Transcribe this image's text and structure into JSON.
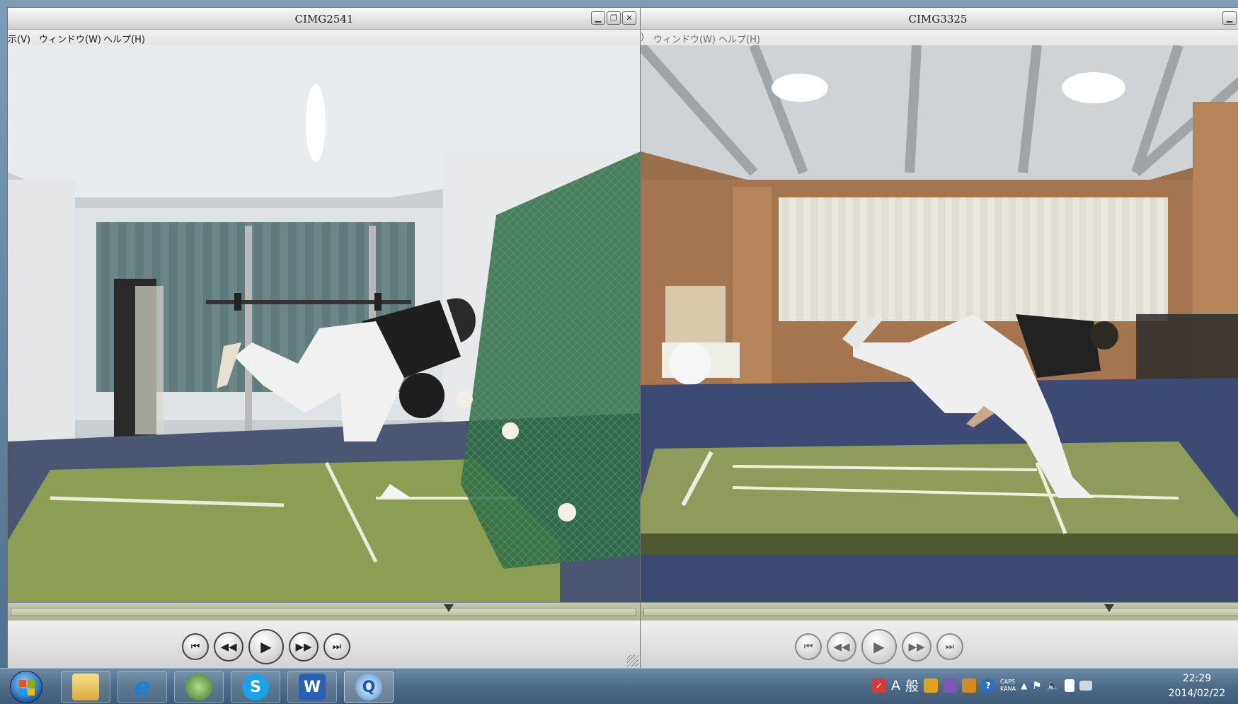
{
  "windows": {
    "left": {
      "title": "CIMG2541",
      "menu": [
        "示(V)",
        "ウィンドウ(W)",
        "ヘルプ(H)"
      ],
      "timeline_position": 0.7
    },
    "right": {
      "title": "CIMG3325",
      "menu": [
        ")",
        "ウィンドウ(W)",
        "ヘルプ(H)"
      ],
      "timeline_position": 0.76
    },
    "window_buttons": {
      "minimize": "▁",
      "maximize": "❐",
      "close": "✕"
    },
    "controls": {
      "to_start": "⏮",
      "rewind": "◀◀",
      "play": "▶",
      "fast_forward": "▶▶",
      "to_end": "⏭"
    }
  },
  "taskbar": {
    "pinned_icons": [
      "windows-start-icon",
      "file-explorer-icon",
      "internet-explorer-icon",
      "media-app-icon",
      "skype-icon",
      "word-icon",
      "quicktime-icon"
    ],
    "word_letter": "W",
    "ie_letter": "e",
    "skype_letter": "S",
    "tray": {
      "ime_mode": "A",
      "ime_kanji": "般",
      "caps": "CAPS",
      "kana": "KANA",
      "help_glyph": "?"
    },
    "clock": {
      "time": "22:29",
      "date": "2014/02/22"
    }
  }
}
